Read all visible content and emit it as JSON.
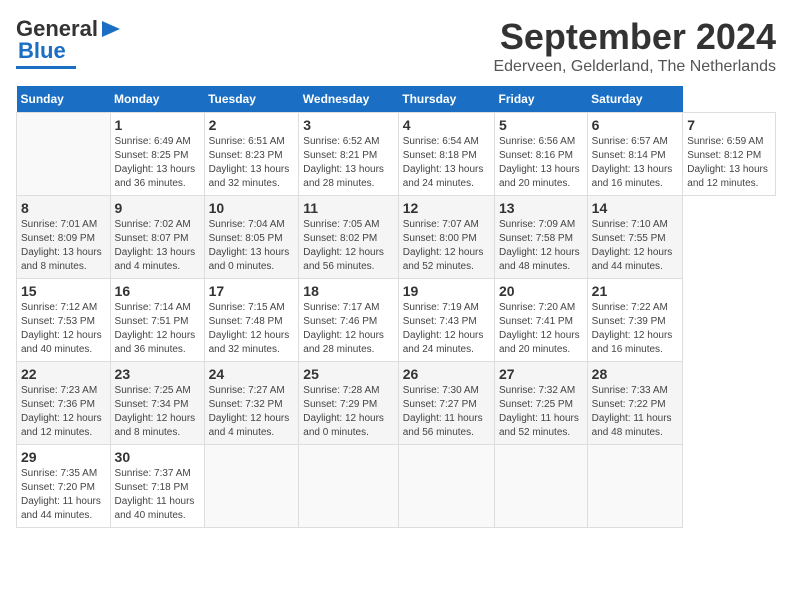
{
  "header": {
    "logo_general": "General",
    "logo_blue": "Blue",
    "month_title": "September 2024",
    "location": "Ederveen, Gelderland, The Netherlands"
  },
  "calendar": {
    "days_of_week": [
      "Sunday",
      "Monday",
      "Tuesday",
      "Wednesday",
      "Thursday",
      "Friday",
      "Saturday"
    ],
    "weeks": [
      [
        {
          "day": "",
          "info": ""
        },
        {
          "day": "1",
          "info": "Sunrise: 6:49 AM\nSunset: 8:25 PM\nDaylight: 13 hours\nand 36 minutes."
        },
        {
          "day": "2",
          "info": "Sunrise: 6:51 AM\nSunset: 8:23 PM\nDaylight: 13 hours\nand 32 minutes."
        },
        {
          "day": "3",
          "info": "Sunrise: 6:52 AM\nSunset: 8:21 PM\nDaylight: 13 hours\nand 28 minutes."
        },
        {
          "day": "4",
          "info": "Sunrise: 6:54 AM\nSunset: 8:18 PM\nDaylight: 13 hours\nand 24 minutes."
        },
        {
          "day": "5",
          "info": "Sunrise: 6:56 AM\nSunset: 8:16 PM\nDaylight: 13 hours\nand 20 minutes."
        },
        {
          "day": "6",
          "info": "Sunrise: 6:57 AM\nSunset: 8:14 PM\nDaylight: 13 hours\nand 16 minutes."
        },
        {
          "day": "7",
          "info": "Sunrise: 6:59 AM\nSunset: 8:12 PM\nDaylight: 13 hours\nand 12 minutes."
        }
      ],
      [
        {
          "day": "8",
          "info": "Sunrise: 7:01 AM\nSunset: 8:09 PM\nDaylight: 13 hours\nand 8 minutes."
        },
        {
          "day": "9",
          "info": "Sunrise: 7:02 AM\nSunset: 8:07 PM\nDaylight: 13 hours\nand 4 minutes."
        },
        {
          "day": "10",
          "info": "Sunrise: 7:04 AM\nSunset: 8:05 PM\nDaylight: 13 hours\nand 0 minutes."
        },
        {
          "day": "11",
          "info": "Sunrise: 7:05 AM\nSunset: 8:02 PM\nDaylight: 12 hours\nand 56 minutes."
        },
        {
          "day": "12",
          "info": "Sunrise: 7:07 AM\nSunset: 8:00 PM\nDaylight: 12 hours\nand 52 minutes."
        },
        {
          "day": "13",
          "info": "Sunrise: 7:09 AM\nSunset: 7:58 PM\nDaylight: 12 hours\nand 48 minutes."
        },
        {
          "day": "14",
          "info": "Sunrise: 7:10 AM\nSunset: 7:55 PM\nDaylight: 12 hours\nand 44 minutes."
        }
      ],
      [
        {
          "day": "15",
          "info": "Sunrise: 7:12 AM\nSunset: 7:53 PM\nDaylight: 12 hours\nand 40 minutes."
        },
        {
          "day": "16",
          "info": "Sunrise: 7:14 AM\nSunset: 7:51 PM\nDaylight: 12 hours\nand 36 minutes."
        },
        {
          "day": "17",
          "info": "Sunrise: 7:15 AM\nSunset: 7:48 PM\nDaylight: 12 hours\nand 32 minutes."
        },
        {
          "day": "18",
          "info": "Sunrise: 7:17 AM\nSunset: 7:46 PM\nDaylight: 12 hours\nand 28 minutes."
        },
        {
          "day": "19",
          "info": "Sunrise: 7:19 AM\nSunset: 7:43 PM\nDaylight: 12 hours\nand 24 minutes."
        },
        {
          "day": "20",
          "info": "Sunrise: 7:20 AM\nSunset: 7:41 PM\nDaylight: 12 hours\nand 20 minutes."
        },
        {
          "day": "21",
          "info": "Sunrise: 7:22 AM\nSunset: 7:39 PM\nDaylight: 12 hours\nand 16 minutes."
        }
      ],
      [
        {
          "day": "22",
          "info": "Sunrise: 7:23 AM\nSunset: 7:36 PM\nDaylight: 12 hours\nand 12 minutes."
        },
        {
          "day": "23",
          "info": "Sunrise: 7:25 AM\nSunset: 7:34 PM\nDaylight: 12 hours\nand 8 minutes."
        },
        {
          "day": "24",
          "info": "Sunrise: 7:27 AM\nSunset: 7:32 PM\nDaylight: 12 hours\nand 4 minutes."
        },
        {
          "day": "25",
          "info": "Sunrise: 7:28 AM\nSunset: 7:29 PM\nDaylight: 12 hours\nand 0 minutes."
        },
        {
          "day": "26",
          "info": "Sunrise: 7:30 AM\nSunset: 7:27 PM\nDaylight: 11 hours\nand 56 minutes."
        },
        {
          "day": "27",
          "info": "Sunrise: 7:32 AM\nSunset: 7:25 PM\nDaylight: 11 hours\nand 52 minutes."
        },
        {
          "day": "28",
          "info": "Sunrise: 7:33 AM\nSunset: 7:22 PM\nDaylight: 11 hours\nand 48 minutes."
        }
      ],
      [
        {
          "day": "29",
          "info": "Sunrise: 7:35 AM\nSunset: 7:20 PM\nDaylight: 11 hours\nand 44 minutes."
        },
        {
          "day": "30",
          "info": "Sunrise: 7:37 AM\nSunset: 7:18 PM\nDaylight: 11 hours\nand 40 minutes."
        },
        {
          "day": "",
          "info": ""
        },
        {
          "day": "",
          "info": ""
        },
        {
          "day": "",
          "info": ""
        },
        {
          "day": "",
          "info": ""
        },
        {
          "day": "",
          "info": ""
        }
      ]
    ]
  }
}
